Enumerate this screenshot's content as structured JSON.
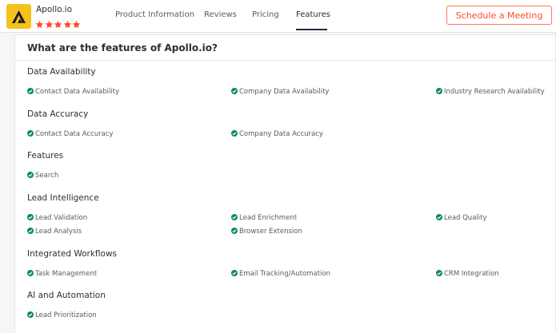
{
  "header": {
    "product_name": "Apollo.io",
    "rating_stars": 5,
    "tabs": [
      "Product Information",
      "Reviews",
      "Pricing",
      "Features"
    ],
    "active_tab": "Features",
    "cta_label": "Schedule a Meeting"
  },
  "card": {
    "title": "What are the features of Apollo.io?",
    "sections": [
      {
        "title": "Data Availability",
        "items": [
          "Contact Data Availability",
          "Company Data Availability",
          "Industry Research Availability"
        ]
      },
      {
        "title": "Data Accuracy",
        "items": [
          "Contact Data Accuracy",
          "Company Data Accuracy"
        ]
      },
      {
        "title": "Features",
        "items": [
          "Search"
        ]
      },
      {
        "title": "Lead Intelligence",
        "items": [
          "Lead Validation",
          "Lead Enrichment",
          "Lead Quality",
          "Lead Analysis",
          "Browser Extension"
        ]
      },
      {
        "title": "Integrated Workflows",
        "items": [
          "Task Management",
          "Email Tracking/Automation",
          "CRM Integration"
        ]
      },
      {
        "title": "AI and Automation",
        "items": [
          "Lead Prioritization"
        ]
      }
    ]
  },
  "colors": {
    "accent_orange": "#ff492c",
    "check_green": "#0a8a5a",
    "logo_yellow": "#f4c21b",
    "star_red": "#ff492c"
  },
  "icons": {
    "check": "check-circle-icon",
    "star": "star-icon",
    "logo": "apollo-logo-icon"
  }
}
